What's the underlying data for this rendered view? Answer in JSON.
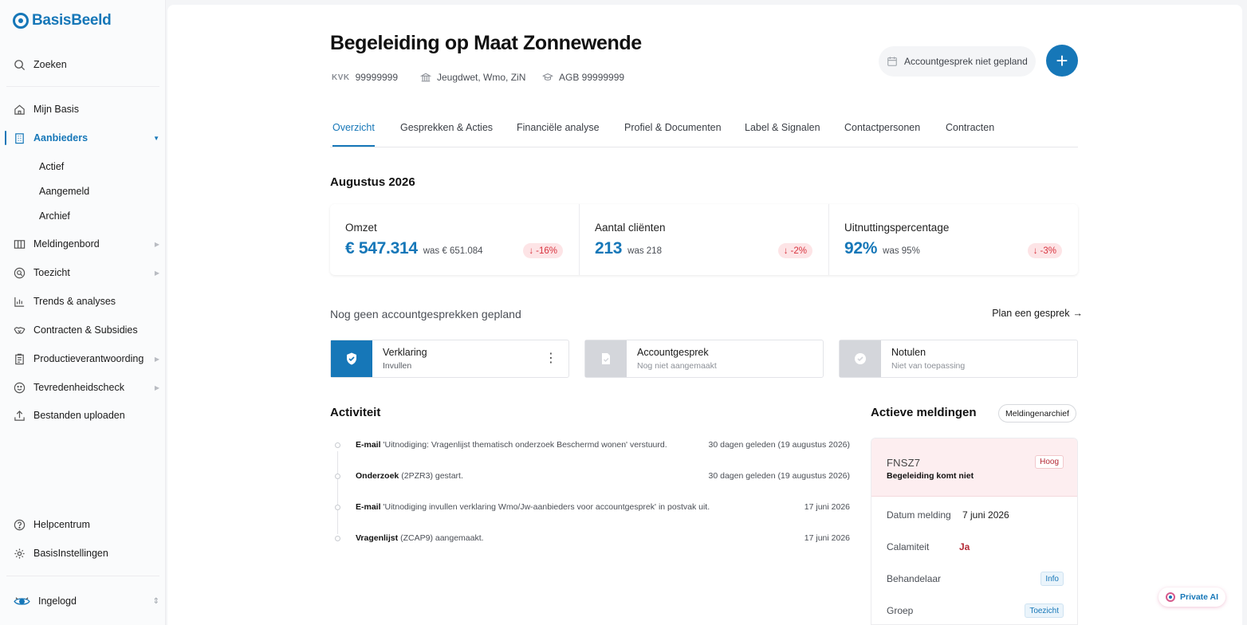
{
  "app": {
    "brand": "BasisBeeld",
    "accent": "#1677b8"
  },
  "sidebar": {
    "search": "Zoeken",
    "items": [
      {
        "label": "Mijn Basis",
        "icon": "home-icon"
      },
      {
        "label": "Aanbieders",
        "icon": "building-icon",
        "active": true
      },
      {
        "label": "Meldingenbord",
        "icon": "columns-icon"
      },
      {
        "label": "Toezicht",
        "icon": "magnifier-circle-icon"
      },
      {
        "label": "Trends & analyses",
        "icon": "chart-icon"
      },
      {
        "label": "Contracten & Subsidies",
        "icon": "handshake-icon"
      },
      {
        "label": "Productieverantwoording",
        "icon": "clipboard-icon"
      },
      {
        "label": "Tevredenheidscheck",
        "icon": "smiley-icon"
      },
      {
        "label": "Bestanden uploaden",
        "icon": "upload-icon"
      }
    ],
    "subitems": [
      "Actief",
      "Aangemeld",
      "Archief"
    ],
    "help": "Helpcentrum",
    "settings": "BasisInstellingen",
    "user": "Ingelogd"
  },
  "header": {
    "title": "Begeleiding op Maat Zonnewende",
    "kvk_label": "KVK",
    "kvk": "99999999",
    "laws": "Jeugdwet, Wmo, ZiN",
    "agb": "AGB 99999999",
    "gesprek_status": "Accountgesprek niet gepland",
    "add_symbol": "+"
  },
  "tabs": [
    "Overzicht",
    "Gesprekken & Acties",
    "Financiële analyse",
    "Profiel & Documenten",
    "Label & Signalen",
    "Contactpersonen",
    "Contracten"
  ],
  "period": "Augustus 2026",
  "stats": [
    {
      "label": "Omzet",
      "value": "€ 547.314",
      "was": "was € 651.084",
      "delta": "-16%"
    },
    {
      "label": "Aantal cliënten",
      "value": "213",
      "was": "was 218",
      "delta": "-2%"
    },
    {
      "label": "Uitnuttingspercentage",
      "value": "92%",
      "was": "was 95%",
      "delta": "-3%"
    }
  ],
  "accountgesprek": {
    "empty": "Nog geen accountgesprekken gepland",
    "plan": "Plan een gesprek",
    "steps": [
      {
        "title": "Verklaring",
        "sub": "Invullen"
      },
      {
        "title": "Accountgesprek",
        "sub": "Nog niet aangemaakt"
      },
      {
        "title": "Notulen",
        "sub": "Niet van toepassing"
      }
    ],
    "kebab": "⋮"
  },
  "activiteit": {
    "title": "Activiteit",
    "rows": [
      {
        "type": "E-mail",
        "text": "'Uitnodiging: Vragenlijst thematisch onderzoek Beschermd wonen' verstuurd.",
        "when": "30 dagen geleden (19 augustus 2026)"
      },
      {
        "type": "Onderzoek",
        "text": "(2PZR3) gestart.",
        "when": "30 dagen geleden (19 augustus 2026)"
      },
      {
        "type": "E-mail",
        "text": "'Uitnodiging invullen verklaring Wmo/Jw-aanbieders voor accountgesprek' in postvak uit.",
        "when": "17 juni 2026"
      },
      {
        "type": "Vragenlijst",
        "text": "(ZCAP9) aangemaakt.",
        "when": "17 juni 2026"
      }
    ]
  },
  "meldingen": {
    "title": "Actieve meldingen",
    "archief": "Meldingenarchief",
    "card": {
      "code": "FNSZ7",
      "priority": "Hoog",
      "subtitle": "Begeleiding komt niet",
      "rows": [
        {
          "label": "Datum melding",
          "value": "7 juni 2026"
        },
        {
          "label": "Calamiteit",
          "value": "Ja"
        },
        {
          "label": "Behandelaar",
          "tag": "Info"
        },
        {
          "label": "Groep",
          "tag": "Toezicht"
        }
      ]
    }
  },
  "private_ai": "Private AI"
}
